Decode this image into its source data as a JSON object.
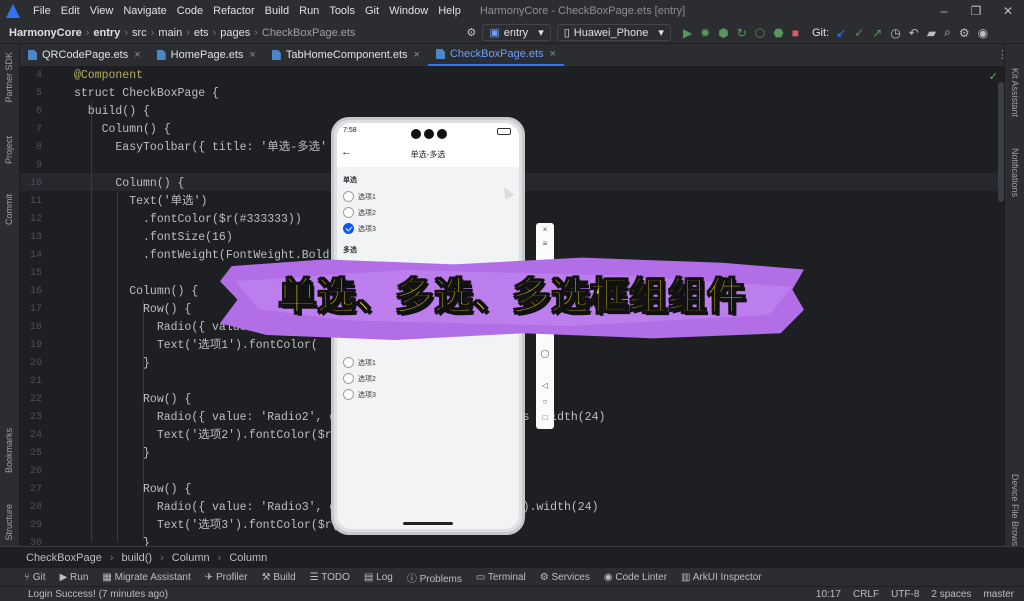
{
  "menu": {
    "items": [
      "File",
      "Edit",
      "View",
      "Navigate",
      "Code",
      "Refactor",
      "Build",
      "Run",
      "Tools",
      "Git",
      "Window",
      "Help"
    ],
    "window_title": "HarmonyCore - CheckBoxPage.ets [entry]"
  },
  "nav": {
    "breadcrumb": [
      "HarmonyCore",
      "entry",
      "src",
      "main",
      "ets",
      "pages",
      "CheckBoxPage.ets"
    ],
    "run_config": "entry",
    "device": "Huawei_Phone",
    "git_label": "Git:"
  },
  "tabs": [
    {
      "label": "QRCodePage.ets"
    },
    {
      "label": "HomePage.ets"
    },
    {
      "label": "TabHomeComponent.ets"
    },
    {
      "label": "CheckBoxPage.ets"
    }
  ],
  "left_strip": [
    "Partner SDK",
    "Project",
    "Commit",
    "Bookmarks",
    "Structure"
  ],
  "right_strip": [
    "Kit Assistant",
    "Notifications",
    "Device File Browser"
  ],
  "code": {
    "line_numbers": [
      4,
      5,
      6,
      7,
      8,
      9,
      10,
      11,
      12,
      13,
      14,
      15,
      16,
      17,
      18,
      19,
      20,
      21,
      22,
      23,
      24,
      25,
      26,
      27,
      28,
      29,
      30
    ],
    "lines": [
      "@Component",
      "struct CheckBoxPage {",
      "  build() {",
      "    Column() {",
      "      EasyToolbar({ title: '单选-多选' })",
      "",
      "      Column() {",
      "        Text('单选')",
      "          .fontColor($r(#333333))",
      "          .fontSize(16)",
      "          .fontWeight(FontWeight.Bold)",
      "",
      "        Column() {",
      "          Row() {",
      "            Radio({ value:",
      "            Text('选项1').fontColor(",
      "          }",
      "",
      "          Row() {",
      "            Radio({ value: 'Radio2', gro                        ls  width(24)",
      "            Text('选项2').fontColor($r(#",
      "          }",
      "",
      "          Row() {",
      "            Radio({ value: 'Radio3', gro                       ue).width(24)",
      "            Text('选项3').fontColor($r(#3",
      "          }"
    ]
  },
  "phone": {
    "time": "7:58",
    "page_title": "单选-多选",
    "section_single": "单选",
    "section_multi": "多选",
    "radio_options": [
      {
        "label": "选项1",
        "checked": false
      },
      {
        "label": "选项2",
        "checked": false
      },
      {
        "label": "选项3",
        "checked": true
      }
    ],
    "lower_options": [
      "选项1",
      "选项2",
      "选项3"
    ]
  },
  "banner_text": "单选、多选、多选框组组件",
  "breadcrumb_bottom": [
    "CheckBoxPage",
    "build()",
    "Column",
    "Column"
  ],
  "tool_windows": [
    "Git",
    "Run",
    "Migrate Assistant",
    "Profiler",
    "Build",
    "TODO",
    "Log",
    "Problems",
    "Terminal",
    "Services",
    "Code Linter",
    "ArkUI Inspector"
  ],
  "status": {
    "message": "Login Success! (7 minutes ago)",
    "position": "10:17",
    "line_sep": "CRLF",
    "encoding": "UTF-8",
    "indent": "2 spaces",
    "branch": "master"
  }
}
